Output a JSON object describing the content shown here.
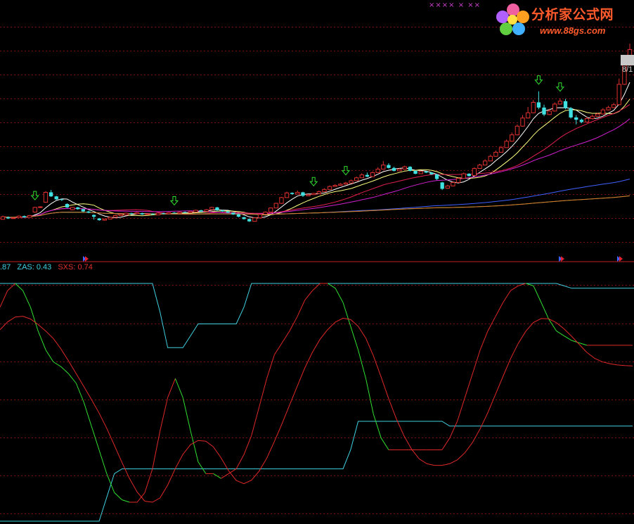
{
  "watermark": {
    "brand_cn": "分析家公式网",
    "url": "www.88gs.com",
    "brand_color": "#ff5a2c"
  },
  "top_markers": "×××× ×  ××",
  "price_tag": "8/1",
  "legend": [
    {
      "label": ".87",
      "color": "#40d0e0"
    },
    {
      "label": "ZAS: 0.43",
      "color": "#40d0e0"
    },
    {
      "label": "SXS: 0.74",
      "color": "#e03030"
    }
  ],
  "colors": {
    "up": "#e03030",
    "down": "#40e0e0",
    "ma5": "#ffffff",
    "ma10": "#ffff80",
    "ma20": "#e02050",
    "ma30": "#d020d0",
    "ma60": "#4060ff",
    "ma120": "#20d020",
    "ma250": "#e07030",
    "grid": "#7a1010",
    "separator": "#c02020",
    "zas": "#40d0e0",
    "sxs_red": "#e02828",
    "sxs_green": "#30e030"
  },
  "chart_data": [
    {
      "type": "candlestick",
      "title": "",
      "grid": "dashed horizontal",
      "candles": [
        [
          0.25,
          0.7,
          0.6,
          0.9
        ],
        [
          0.6,
          0.4,
          0.3,
          0.75
        ],
        [
          0.4,
          0.5,
          0.35,
          0.6
        ],
        [
          0.55,
          0.8,
          0.5,
          0.9
        ],
        [
          0.8,
          0.6,
          0.5,
          0.9
        ],
        [
          0.6,
          0.9,
          0.55,
          1.0
        ],
        [
          1.5,
          2.3,
          1.4,
          2.4
        ],
        [
          2.3,
          2.4,
          2.2,
          2.5
        ],
        [
          3.2,
          4.9,
          3.1,
          5.1
        ],
        [
          4.9,
          4.2,
          4.1,
          5.3
        ],
        [
          4.2,
          3.7,
          3.6,
          4.3
        ],
        [
          3.7,
          3.6,
          3.4,
          3.8
        ],
        [
          2.9,
          2.3,
          2.2,
          3.0
        ],
        [
          1.9,
          2.3,
          1.8,
          2.4
        ],
        [
          2.3,
          2.0,
          1.9,
          2.4
        ],
        [
          2.0,
          1.6,
          1.5,
          2.1
        ],
        [
          1.6,
          1.4,
          1.3,
          1.7
        ],
        [
          1.0,
          0.7,
          0.2,
          1.1
        ],
        [
          0.4,
          0.1,
          0.0,
          0.5
        ],
        [
          0.1,
          0.3,
          0.0,
          0.35
        ],
        [
          0.3,
          0.6,
          0.25,
          0.7
        ],
        [
          0.6,
          0.9,
          0.55,
          1.0
        ],
        [
          0.9,
          1.1,
          0.85,
          1.2
        ],
        [
          1.0,
          1.3,
          0.95,
          1.4
        ],
        [
          1.3,
          1.2,
          1.1,
          1.4
        ],
        [
          1.2,
          1.4,
          1.15,
          1.5
        ],
        [
          1.3,
          1.1,
          1.0,
          1.4
        ],
        [
          1.1,
          1.2,
          1.05,
          1.3
        ],
        [
          1.2,
          1.1,
          1.0,
          1.3
        ],
        [
          1.0,
          1.3,
          0.95,
          1.4
        ],
        [
          1.3,
          1.2,
          1.1,
          1.4
        ],
        [
          1.2,
          1.4,
          1.15,
          1.5
        ],
        [
          1.4,
          1.3,
          1.25,
          1.5
        ],
        [
          1.3,
          1.5,
          1.25,
          1.6
        ],
        [
          1.5,
          1.4,
          1.35,
          1.6
        ],
        [
          1.4,
          1.6,
          1.35,
          1.7
        ],
        [
          1.5,
          1.8,
          1.45,
          1.9
        ],
        [
          1.8,
          1.6,
          1.55,
          1.9
        ],
        [
          1.6,
          1.9,
          1.55,
          2.0
        ],
        [
          1.9,
          2.3,
          1.85,
          2.4
        ],
        [
          2.3,
          1.8,
          1.7,
          2.4
        ],
        [
          1.8,
          1.6,
          1.55,
          1.9
        ],
        [
          1.6,
          1.4,
          1.3,
          1.7
        ],
        [
          1.4,
          1.1,
          1.0,
          1.5
        ],
        [
          1.1,
          0.7,
          0.6,
          1.2
        ],
        [
          0.6,
          0.3,
          0.2,
          0.7
        ],
        [
          0.3,
          -0.1,
          -0.2,
          0.4
        ],
        [
          -0.1,
          0.5,
          -0.15,
          0.6
        ],
        [
          0.5,
          1.1,
          0.45,
          1.2
        ],
        [
          1.1,
          1.5,
          1.05,
          1.6
        ],
        [
          1.5,
          2.2,
          1.45,
          2.3
        ],
        [
          2.2,
          3.0,
          2.15,
          3.1
        ],
        [
          3.0,
          4.0,
          2.9,
          4.1
        ],
        [
          4.0,
          4.8,
          3.95,
          5.0
        ],
        [
          4.8,
          4.6,
          4.5,
          4.9
        ],
        [
          4.6,
          4.9,
          4.55,
          5.2
        ],
        [
          4.9,
          4.3,
          4.1,
          5.0
        ],
        [
          4.3,
          4.5,
          4.25,
          4.6
        ],
        [
          4.5,
          4.7,
          4.45,
          4.8
        ],
        [
          4.7,
          5.0,
          4.65,
          5.2
        ],
        [
          5.0,
          5.4,
          4.95,
          5.6
        ],
        [
          5.4,
          5.9,
          5.35,
          6.1
        ],
        [
          5.9,
          6.1,
          5.85,
          6.3
        ],
        [
          6.1,
          6.3,
          6.05,
          6.5
        ],
        [
          6.3,
          6.5,
          6.25,
          6.7
        ],
        [
          6.5,
          6.9,
          6.45,
          7.1
        ],
        [
          6.9,
          7.4,
          6.85,
          7.6
        ],
        [
          7.4,
          7.9,
          7.35,
          8.2
        ],
        [
          7.9,
          7.6,
          7.5,
          8.3
        ],
        [
          7.6,
          8.3,
          7.55,
          8.5
        ],
        [
          8.3,
          8.9,
          8.25,
          9.2
        ],
        [
          8.9,
          9.6,
          8.85,
          10.3
        ],
        [
          9.6,
          9.1,
          9.0,
          9.9
        ],
        [
          9.1,
          8.6,
          8.5,
          9.3
        ],
        [
          8.6,
          8.9,
          8.55,
          9.1
        ],
        [
          8.9,
          9.3,
          8.85,
          9.5
        ],
        [
          9.3,
          8.6,
          8.5,
          9.4
        ],
        [
          8.6,
          8.1,
          8.0,
          8.7
        ],
        [
          8.1,
          8.5,
          8.05,
          8.6
        ],
        [
          8.5,
          8.3,
          8.2,
          8.6
        ],
        [
          8.3,
          8.0,
          7.9,
          8.4
        ],
        [
          8.0,
          7.2,
          7.0,
          8.1
        ],
        [
          6.6,
          5.5,
          5.3,
          6.7
        ],
        [
          5.6,
          6.0,
          5.5,
          6.2
        ],
        [
          6.0,
          6.6,
          5.95,
          6.8
        ],
        [
          6.6,
          7.3,
          6.55,
          7.5
        ],
        [
          7.3,
          8.1,
          7.25,
          8.3
        ],
        [
          8.1,
          7.7,
          7.6,
          8.2
        ],
        [
          7.8,
          9.0,
          7.75,
          9.2
        ],
        [
          9.0,
          9.6,
          8.95,
          9.8
        ],
        [
          9.6,
          10.3,
          9.55,
          10.6
        ],
        [
          10.3,
          11.1,
          10.25,
          11.4
        ],
        [
          11.1,
          11.8,
          11.05,
          12.1
        ],
        [
          11.8,
          12.6,
          11.75,
          12.9
        ],
        [
          12.6,
          13.7,
          12.55,
          14.0
        ],
        [
          13.7,
          14.8,
          13.6,
          15.2
        ],
        [
          14.8,
          16.3,
          14.7,
          16.6
        ],
        [
          16.3,
          17.7,
          16.2,
          18.2
        ],
        [
          17.7,
          18.6,
          17.6,
          19.6
        ],
        [
          18.6,
          20.4,
          18.5,
          20.8
        ],
        [
          20.4,
          19.5,
          19.2,
          22.3
        ],
        [
          19.5,
          18.3,
          18.0,
          20.0
        ],
        [
          18.3,
          18.9,
          18.2,
          19.3
        ],
        [
          18.9,
          20.1,
          18.8,
          20.4
        ],
        [
          20.1,
          20.6,
          20.0,
          21.1
        ],
        [
          20.6,
          19.4,
          19.2,
          21.0
        ],
        [
          19.4,
          17.8,
          17.6,
          19.6
        ],
        [
          17.8,
          17.4,
          16.6,
          18.2
        ],
        [
          17.4,
          17.0,
          16.8,
          17.6
        ],
        [
          17.0,
          17.6,
          16.9,
          17.9
        ],
        [
          17.6,
          18.0,
          17.5,
          18.3
        ],
        [
          18.0,
          18.4,
          17.9,
          18.6
        ],
        [
          18.4,
          19.1,
          18.3,
          19.4
        ],
        [
          19.1,
          19.5,
          19.0,
          19.8
        ],
        [
          19.5,
          20.0,
          19.4,
          20.3
        ],
        [
          20.0,
          23.5,
          19.9,
          24.5
        ],
        [
          23.5,
          26.8,
          23.4,
          27.5
        ],
        [
          26.8,
          29.5,
          26.7,
          30.5
        ]
      ],
      "candle_order": "open, close, low, high",
      "arrows_at_index": [
        6,
        32,
        58,
        64,
        100,
        104
      ],
      "overlay_ylim": [
        -0.5,
        31
      ]
    },
    {
      "type": "line",
      "title": "",
      "ylim": [
        0,
        1
      ],
      "grid": "dashed horizontal",
      "series": [
        {
          "name": "ZAS",
          "values": [
            1,
            1,
            1,
            1,
            1,
            1,
            1,
            1,
            1,
            1,
            1,
            1,
            1,
            1,
            1,
            1,
            1,
            1,
            1,
            1,
            1,
            0.88,
            0.73,
            0.73,
            0.73,
            0.78,
            0.83,
            0.83,
            0.83,
            0.83,
            0.83,
            0.83,
            0.9,
            1,
            1,
            1,
            1,
            1,
            1,
            1,
            1,
            1,
            1,
            1,
            1,
            1,
            1,
            1,
            1,
            1,
            1,
            1,
            1,
            1,
            1,
            1,
            1,
            1,
            1,
            1,
            1,
            1,
            1,
            1,
            1,
            1,
            1,
            1,
            1,
            1,
            1,
            1,
            1,
            1,
            0.99,
            0.98,
            0.98,
            0.98,
            0.98,
            0.98,
            0.98,
            0.98,
            0.98,
            0.98,
            0.98
          ]
        },
        {
          "name": "SXS",
          "values": [
            0.9,
            0.97,
            1,
            0.97,
            0.9,
            0.8,
            0.72,
            0.67,
            0.65,
            0.62,
            0.58,
            0.5,
            0.4,
            0.3,
            0.2,
            0.12,
            0.09,
            0.08,
            0.08,
            0.12,
            0.22,
            0.38,
            0.52,
            0.6,
            0.52,
            0.38,
            0.25,
            0.2,
            0.2,
            0.18,
            0.2,
            0.22,
            0.28,
            0.36,
            0.48,
            0.6,
            0.7,
            0.75,
            0.8,
            0.86,
            0.93,
            0.97,
            1,
            1,
            0.98,
            0.92,
            0.82,
            0.72,
            0.6,
            0.45,
            0.35,
            0.3,
            0.3,
            0.3,
            0.3,
            0.3,
            0.3,
            0.3,
            0.3,
            0.35,
            0.42,
            0.52,
            0.62,
            0.72,
            0.8,
            0.86,
            0.92,
            0.97,
            0.99,
            1,
            0.99,
            0.92,
            0.85,
            0.8,
            0.78,
            0.76,
            0.75,
            0.74,
            0.74,
            0.74,
            0.74,
            0.74,
            0.74,
            0.74
          ]
        }
      ],
      "x_count": 84
    }
  ]
}
